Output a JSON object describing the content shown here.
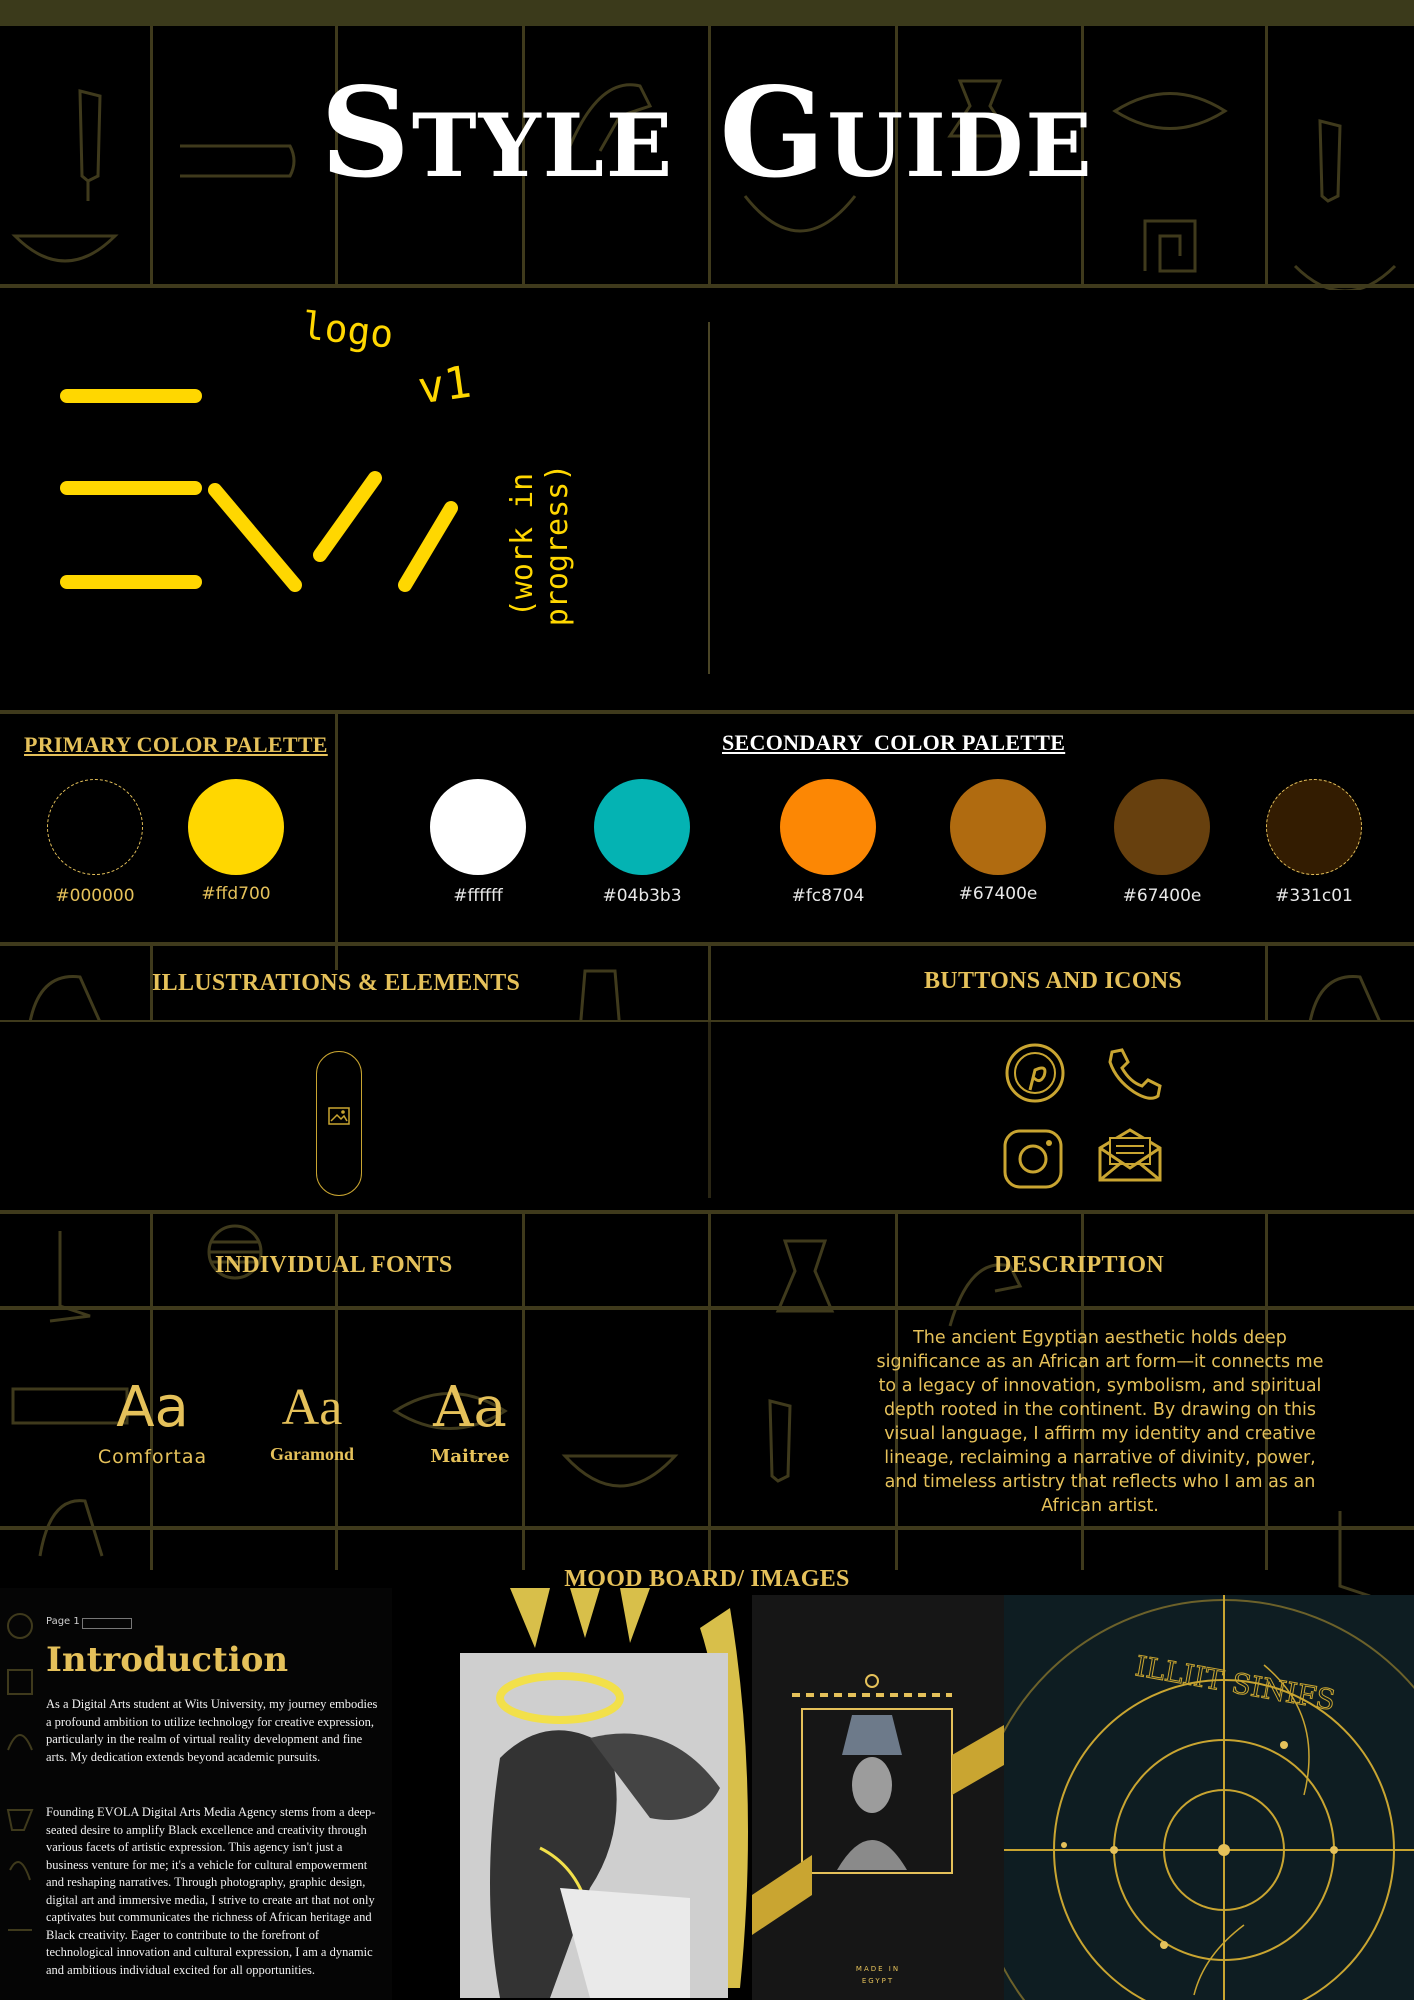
{
  "header": {
    "title": "Style Guide"
  },
  "logo": {
    "note_logo": "logo",
    "note_version": "v1",
    "note_wip": "(work in progress)",
    "color": "#ffd700"
  },
  "primary_palette": {
    "heading": "PRIMARY COLOR PALETTE",
    "colors": [
      {
        "hex": "#000000",
        "label": "#000000"
      },
      {
        "hex": "#ffd700",
        "label": "#ffd700"
      }
    ]
  },
  "secondary_palette": {
    "heading": "SECONDARY  COLOR PALETTE",
    "colors": [
      {
        "hex": "#ffffff",
        "label": "#ffffff"
      },
      {
        "hex": "#04b3b3",
        "label": "#04b3b3"
      },
      {
        "hex": "#fc8704",
        "label": "#fc8704"
      },
      {
        "hex": "#b06b10",
        "label": "#67400e"
      },
      {
        "hex": "#67400e",
        "label": "#67400e"
      },
      {
        "hex": "#331c01",
        "label": "#331c01"
      }
    ]
  },
  "sections": {
    "illustrations": "ILLUSTRATIONS & ELEMENTS",
    "buttons": "BUTTONS AND ICONS",
    "fonts": "INDIVIDUAL FONTS",
    "description": "DESCRIPTION",
    "mood": "MOOD BOARD/ IMAGES"
  },
  "icons": [
    "pinterest-icon",
    "phone-icon",
    "instagram-icon",
    "mail-icon"
  ],
  "fonts": [
    {
      "sample": "Aa",
      "name": "Comfortaa"
    },
    {
      "sample": "Aa",
      "name": "Garamond"
    },
    {
      "sample": "Aa",
      "name": "Maitree"
    }
  ],
  "description": "The ancient Egyptian aesthetic holds deep significance as an African art form—it connects me to a legacy of innovation, symbolism, and spiritual depth rooted in the continent. By drawing on this visual language, I affirm my identity and creative lineage, reclaiming a narrative of divinity, power, and timeless artistry that reflects who I am as an African artist.",
  "intro": {
    "page_label": "Page 1",
    "title": "Introduction",
    "p1": "As a Digital Arts student at Wits University, my journey embodies a profound ambition to utilize technology for creative expression, particularly in the realm of virtual reality development and fine arts. My dedication extends beyond academic pursuits.",
    "p2": "Founding EVOLA Digital Arts Media Agency stems from a deep-seated desire to amplify Black excellence and creativity through various facets of artistic expression. This agency isn't just a business venture for me; it's a vehicle for cultural empowerment and reshaping narratives. Through photography, graphic design, digital art and immersive media, I strive to create art that not only captivates but communicates the richness of African heritage and Black creativity. Eager to contribute to the forefront of technological innovation and cultural expression, I am a dynamic and ambitious individual excited for all opportunities."
  },
  "poster": {
    "caption_top": "MADE IN",
    "caption_bottom": "EGYPT"
  },
  "map": {
    "inscription": "ILLIIT SINIFS"
  },
  "accent": "#e5c15a",
  "grid_color": "#3f3a1c"
}
